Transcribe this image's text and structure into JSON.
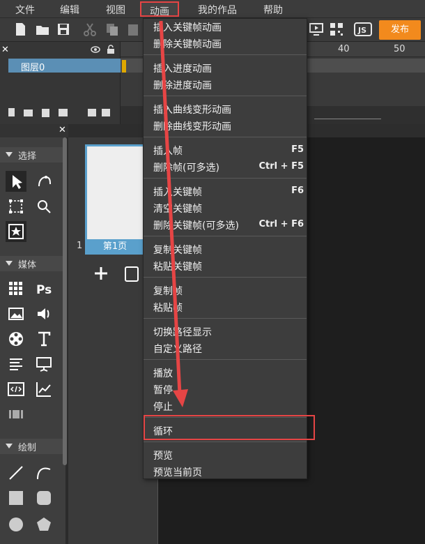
{
  "menubar": {
    "items": [
      "文件",
      "编辑",
      "视图",
      "动画",
      "我的作品",
      "帮助"
    ]
  },
  "toolbar": {
    "publish_label": "发布"
  },
  "timeline": {
    "layer_name": "图层0",
    "ruler_numbers": [
      "40",
      "50"
    ]
  },
  "tools": {
    "sections": [
      "选择",
      "媒体",
      "绘制"
    ]
  },
  "pages": {
    "page_number": "1",
    "page_label": "第1页"
  },
  "dropdown": {
    "items": [
      {
        "label": "插入关键帧动画",
        "key": ""
      },
      {
        "label": "删除关键帧动画",
        "key": ""
      },
      {
        "label": "插入进度动画",
        "key": ""
      },
      {
        "label": "删除进度动画",
        "key": ""
      },
      {
        "label": "插入曲线变形动画",
        "key": ""
      },
      {
        "label": "删除曲线变形动画",
        "key": ""
      },
      {
        "label": "插入帧",
        "key": "F5"
      },
      {
        "label": "删除帧(可多选)",
        "key": "Ctrl + F5"
      },
      {
        "label": "插入关键帧",
        "key": "F6"
      },
      {
        "label": "清空关键帧",
        "key": ""
      },
      {
        "label": "删除关键帧(可多选)",
        "key": "Ctrl + F6"
      },
      {
        "label": "复制关键帧",
        "key": ""
      },
      {
        "label": "粘贴关键帧",
        "key": ""
      },
      {
        "label": "复制帧",
        "key": ""
      },
      {
        "label": "粘贴帧",
        "key": ""
      },
      {
        "label": "切换路径显示",
        "key": ""
      },
      {
        "label": "自定义路径",
        "key": ""
      },
      {
        "label": "播放",
        "key": ""
      },
      {
        "label": "暂停",
        "key": ""
      },
      {
        "label": "停止",
        "key": ""
      },
      {
        "label": "循环",
        "key": ""
      },
      {
        "label": "预览",
        "key": ""
      },
      {
        "label": "预览当前页",
        "key": ""
      }
    ]
  },
  "colors": {
    "accent_orange": "#f28a1d",
    "highlight_red": "#e64545",
    "layer_blue": "#5b8fb5"
  }
}
